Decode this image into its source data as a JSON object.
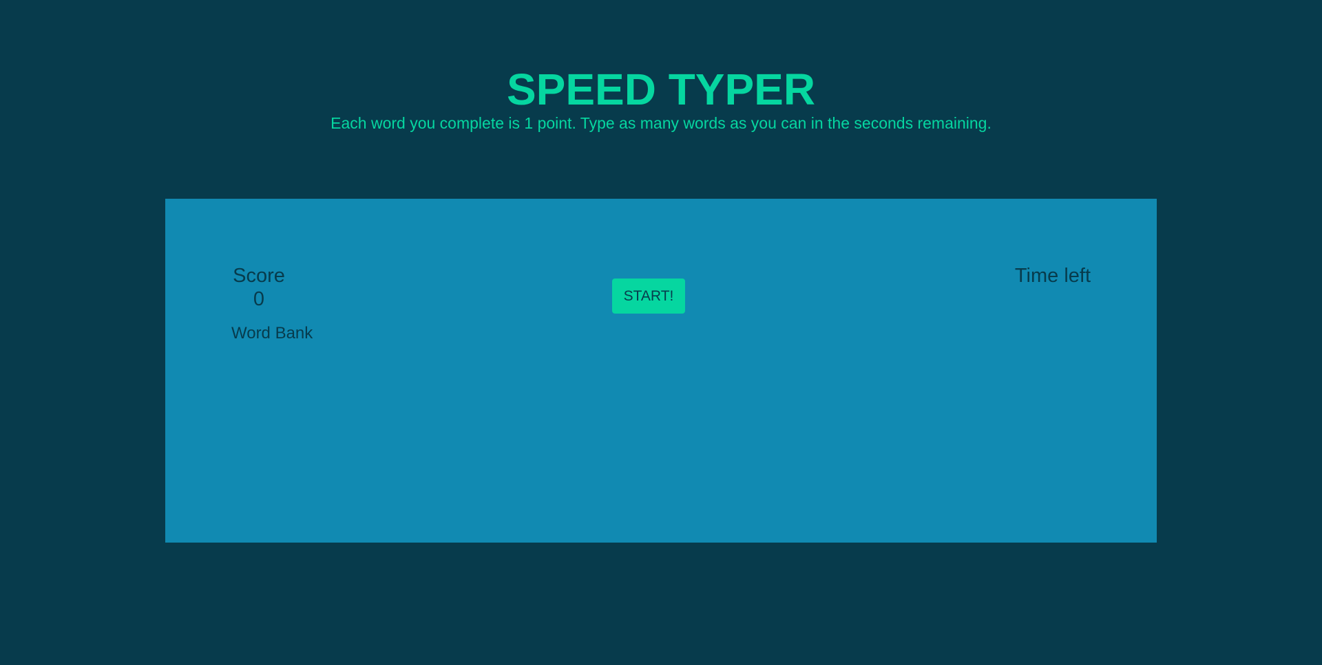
{
  "header": {
    "title": "SPEED TYPER",
    "subtitle": "Each word you complete is 1 point. Type as many words as you can in the seconds remaining."
  },
  "game": {
    "score_label": "Score",
    "score_value": "0",
    "word_bank_label": "Word Bank",
    "start_label": "START!",
    "time_left_label": "Time left"
  },
  "colors": {
    "background": "#073b4c",
    "panel": "#118ab2",
    "accent": "#06d6a0",
    "text_dark": "#073b4c"
  }
}
